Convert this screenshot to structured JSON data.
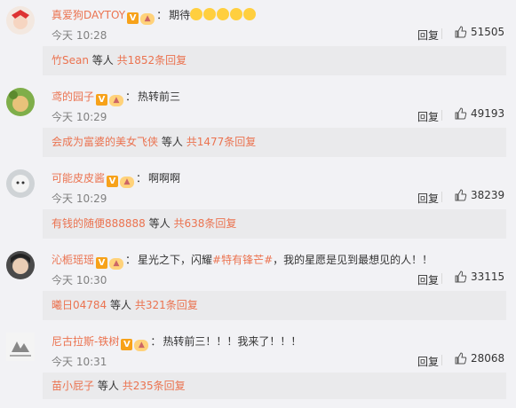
{
  "comments": [
    {
      "user": "真爱狗DAYTOY",
      "text": "期待",
      "emoji_count": 5,
      "time": "今天 10:28",
      "reply_label": "回复",
      "likes": "51505",
      "sub": {
        "users": "竹Sean",
        "others": "等人",
        "count": "共1852条回复"
      }
    },
    {
      "user": "鸢的园子",
      "text": "热转前三",
      "time": "今天 10:29",
      "reply_label": "回复",
      "likes": "49193",
      "sub": {
        "users": "会成为富婆的美女飞侠",
        "others": "等人",
        "count": "共1477条回复"
      }
    },
    {
      "user": "可能皮皮酱",
      "text": "啊啊啊",
      "time": "今天 10:29",
      "reply_label": "回复",
      "likes": "38239",
      "sub": {
        "users": "有钱的随便888888",
        "others": "等人",
        "count": "共638条回复"
      }
    },
    {
      "user": "沁栀瑶瑶",
      "text_pre": "星光之下，闪耀",
      "topic": "#特有锋芒#",
      "text_post": "，我的星愿是见到最想见的人！！",
      "time": "今天 10:30",
      "reply_label": "回复",
      "likes": "33115",
      "sub": {
        "users": "曦日04784",
        "others": "等人",
        "count": "共321条回复"
      }
    },
    {
      "user": "尼古拉斯-铁树",
      "text": "热转前三！！！我来了！！！",
      "time": "今天 10:31",
      "reply_label": "回复",
      "likes": "28068",
      "sub": {
        "users": "苗小屁子",
        "others": "等人",
        "count": "共235条回复"
      }
    }
  ],
  "badges": {
    "verified": "V",
    "level": "vip"
  },
  "colors": {
    "accent": "#eb7350",
    "background": "#f2f2f5",
    "subbox": "#eaeaec"
  }
}
